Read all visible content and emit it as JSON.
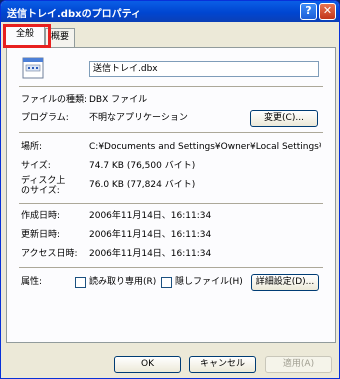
{
  "window": {
    "title": "送信トレイ.dbxのプロパティ",
    "help_glyph": "?",
    "close_glyph": "✕"
  },
  "tabs": [
    {
      "label": "全般"
    },
    {
      "label": "概要"
    }
  ],
  "general": {
    "file_name": "送信トレイ.dbx",
    "type_label": "ファイルの種類:",
    "type_value": "DBX ファイル",
    "program_label": "プログラム:",
    "program_value": "不明なアプリケーション",
    "change_button": "変更(C)...",
    "location_label": "場所:",
    "location_value": "C:¥Documents and Settings¥Owner¥Local Settings¥Appl",
    "size_label": "サイズ:",
    "size_value": "74.7 KB (76,500 バイト)",
    "size_on_disk_label_1": "ディスク上",
    "size_on_disk_label_2": "のサイズ:",
    "size_on_disk_value": "76.0 KB (77,824 バイト)",
    "created_label": "作成日時:",
    "created_value": "2006年11月14日、16:11:34",
    "modified_label": "更新日時:",
    "modified_value": "2006年11月14日、16:11:34",
    "accessed_label": "アクセス日時:",
    "accessed_value": "2006年11月14日、16:11:34",
    "attributes_label": "属性:",
    "readonly_label": "読み取り専用(R)",
    "hidden_label": "隠しファイル(H)",
    "advanced_button": "詳細設定(D)..."
  },
  "footer": {
    "ok": "OK",
    "cancel": "キャンセル",
    "apply": "適用(A)"
  }
}
